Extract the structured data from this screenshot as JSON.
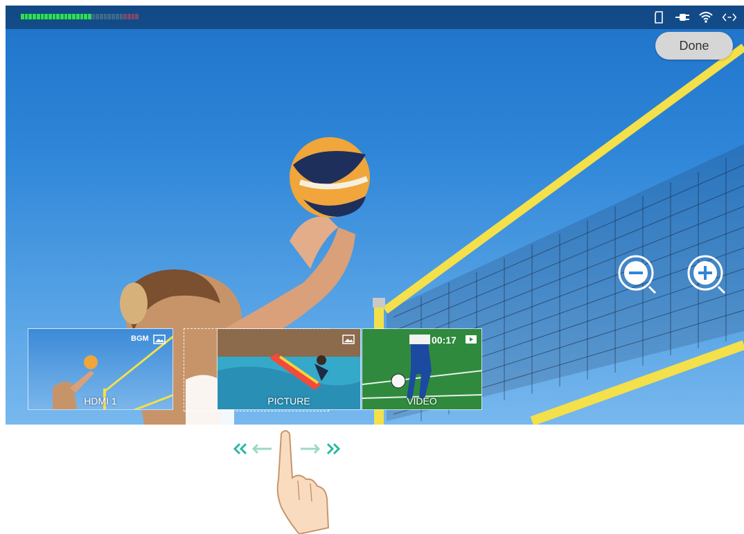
{
  "statusbar": {
    "icons": [
      "sd-card-icon",
      "power-plug-icon",
      "wifi-icon",
      "network-link-icon"
    ]
  },
  "done_label": "Done",
  "zoom": {
    "out_icon": "zoom-out-icon",
    "in_icon": "zoom-in-icon"
  },
  "sources": [
    {
      "label": "HDMI 1",
      "badge": "BGM",
      "badge_icon": "image-icon"
    },
    {
      "label": "PICTURE",
      "badge_icon": "image-icon"
    },
    {
      "label": "VIDEO",
      "time": "00:17",
      "badge_icon": "play-icon"
    }
  ],
  "gesture": {
    "hint": "swipe-left-right"
  },
  "colors": {
    "accent": "#1e73c9",
    "meter_green": "#2ee04a",
    "gesture_teal": "#2bb8a0"
  }
}
